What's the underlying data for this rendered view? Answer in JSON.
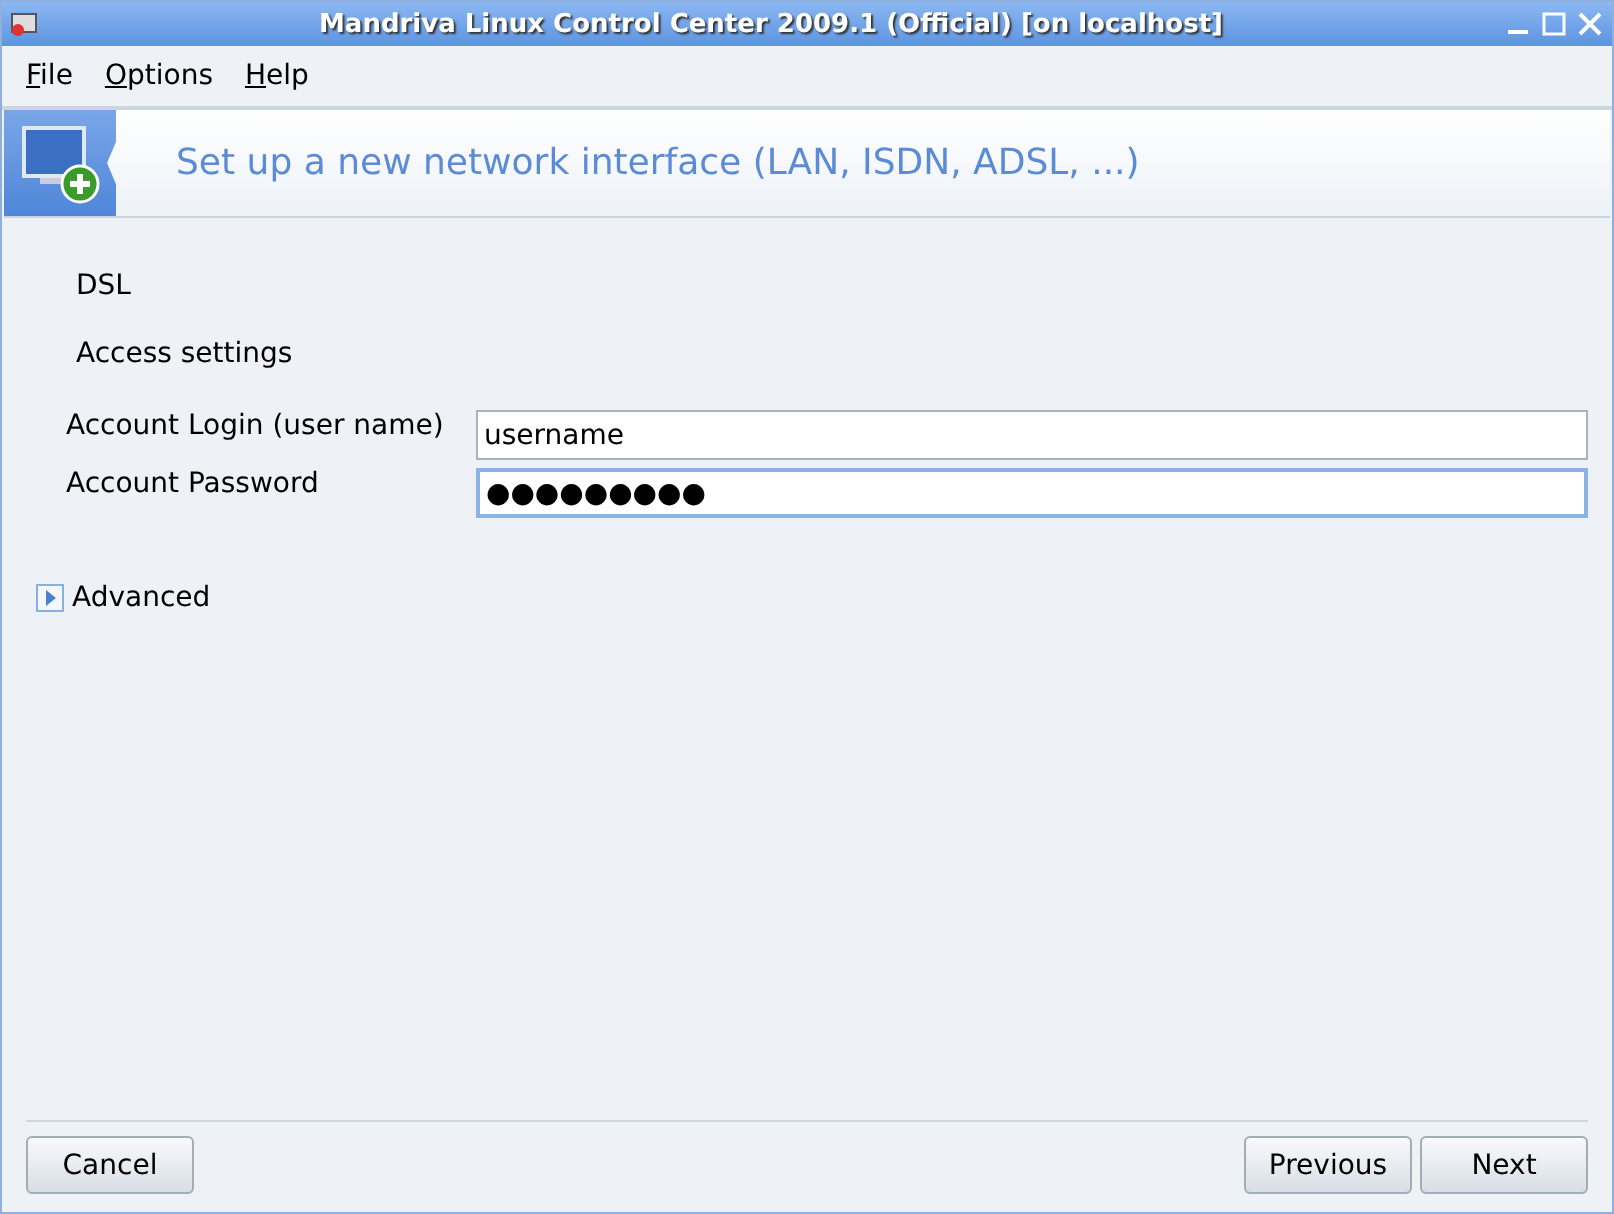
{
  "window": {
    "title": "Mandriva Linux Control Center 2009.1 (Official) [on localhost]"
  },
  "menu": [
    "File",
    "Options",
    "Help"
  ],
  "banner": {
    "title": "Set up a new network interface (LAN, ISDN, ADSL, ...)"
  },
  "section": "DSL",
  "subtitle": "Access settings",
  "fields": [
    {
      "label": "Account Login (user name)",
      "value": "username",
      "focused": false
    },
    {
      "label": "Account Password",
      "value": "●●●●●●●●●",
      "focused": true
    }
  ],
  "advanced": {
    "label": "Advanced",
    "expanded": false
  },
  "buttons": {
    "left": [
      "Cancel"
    ],
    "right": [
      "Previous",
      "Next"
    ]
  }
}
